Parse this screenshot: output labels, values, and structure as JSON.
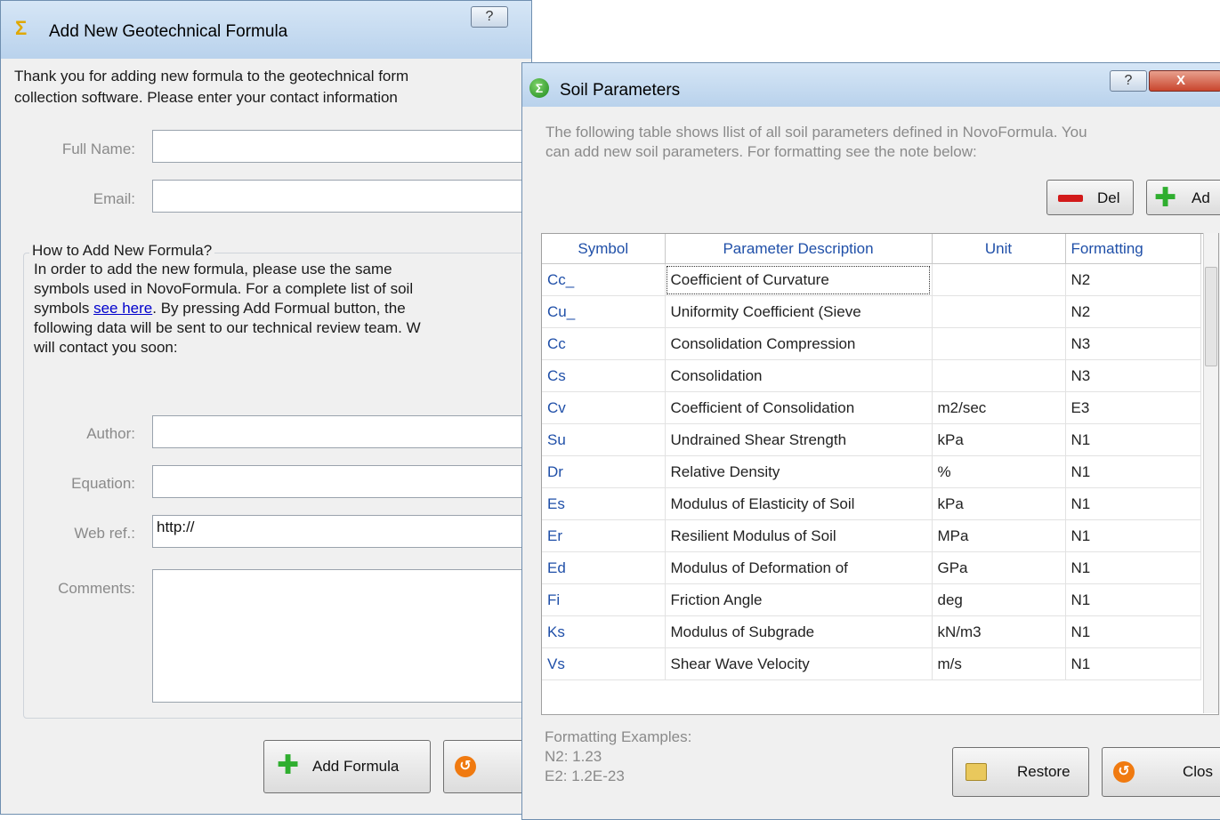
{
  "left_window": {
    "title": "Add New Geotechnical Formula",
    "help_label": "?",
    "intro_lines": [
      "Thank you for adding new formula to the geotechnical form",
      "collection software. Please enter your contact information"
    ],
    "full_name": {
      "label": "Full Name:",
      "value": ""
    },
    "email": {
      "label": "Email:",
      "value": ""
    },
    "group": {
      "title": "How to Add New Formula?",
      "line1": "In order to add the new formula, please use the same",
      "line2": "symbols used in NovoFormula. For a complete list of soil",
      "line3_prefix": "symbols ",
      "line3_link": "see here",
      "line3_suffix": ". By pressing Add Formual button, the",
      "line4": "following data will be sent to our technical review team. W",
      "line5": "will contact you soon:"
    },
    "author": {
      "label": "Author:",
      "value": ""
    },
    "equation": {
      "label": "Equation:",
      "value": ""
    },
    "web_ref": {
      "label": "Web ref.:",
      "value": "http://"
    },
    "comments": {
      "label": "Comments:",
      "value": ""
    },
    "add_formula_label": "Add Formula",
    "cancel_label": ""
  },
  "right_window": {
    "title": "Soil Parameters",
    "help_label": "?",
    "close_label": "X",
    "intro_line1": "The following table shows llist of all soil parameters defined in NovoFormula. You",
    "intro_line2": "can add new soil parameters. For formatting see the note below:",
    "del_label": "Del",
    "add_label": "Ad",
    "columns": [
      "Symbol",
      "Parameter Description",
      "Unit",
      "Formatting"
    ],
    "rows": [
      {
        "symbol": "Cc_",
        "description": "Coefficient of Curvature",
        "unit": "",
        "formatting": "N2"
      },
      {
        "symbol": "Cu_",
        "description": "Uniformity Coefficient (Sieve",
        "unit": "",
        "formatting": "N2"
      },
      {
        "symbol": "Cc",
        "description": "Consolidation Compression",
        "unit": "",
        "formatting": "N3"
      },
      {
        "symbol": "Cs",
        "description": "Consolidation",
        "unit": "",
        "formatting": "N3"
      },
      {
        "symbol": "Cv",
        "description": "Coefficient of Consolidation",
        "unit": "m2/sec",
        "formatting": "E3"
      },
      {
        "symbol": "Su",
        "description": "Undrained Shear Strength",
        "unit": "kPa",
        "formatting": "N1"
      },
      {
        "symbol": "Dr",
        "description": "Relative Density",
        "unit": "%",
        "formatting": "N1"
      },
      {
        "symbol": "Es",
        "description": "Modulus of Elasticity of Soil",
        "unit": "kPa",
        "formatting": "N1"
      },
      {
        "symbol": "Er",
        "description": "Resilient Modulus of Soil",
        "unit": "MPa",
        "formatting": "N1"
      },
      {
        "symbol": "Ed",
        "description": "Modulus of Deformation of",
        "unit": "GPa",
        "formatting": "N1"
      },
      {
        "symbol": "Fi",
        "description": "Friction Angle",
        "unit": "deg",
        "formatting": "N1"
      },
      {
        "symbol": "Ks",
        "description": "Modulus of Subgrade",
        "unit": "kN/m3",
        "formatting": "N1"
      },
      {
        "symbol": "Vs",
        "description": "Shear Wave Velocity",
        "unit": "m/s",
        "formatting": "N1"
      }
    ],
    "formatting_examples": {
      "title": "Formatting Examples:",
      "line1": "N2: 1.23",
      "line2": "E2: 1.2E-23"
    },
    "restore_label": "Restore",
    "close_button_label": "Clos"
  },
  "colors": {
    "title_gradient_top": "#d6e6f6",
    "title_gradient_bottom": "#b9d2ec",
    "symbol_text": "#1f4fa8",
    "link": "#0000cc",
    "plus_icon": "#2fae2f",
    "minus_icon": "#d21a1a",
    "undo_icon": "#f07a10"
  }
}
